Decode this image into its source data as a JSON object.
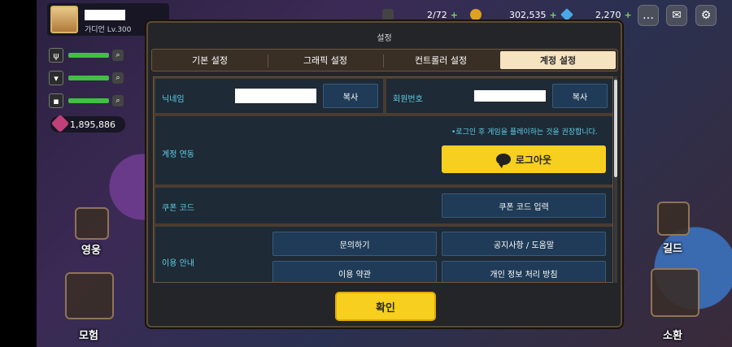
{
  "hud": {
    "level": "가디언 Lv.300",
    "resource1": "2/72",
    "resource2": "302,535",
    "resource3": "2,270",
    "gems": "1,895,886"
  },
  "side": {
    "hero": "영웅",
    "adventure": "모험",
    "guild": "길드",
    "summon": "소환"
  },
  "dialog": {
    "title": "설정",
    "tabs": [
      "기본 설정",
      "그래픽 설정",
      "컨트롤러 설정",
      "계정 설정"
    ],
    "nickname_label": "닉네임",
    "copy_label": "복사",
    "member_label": "회원번호",
    "account_link_label": "계정 연동",
    "login_note": "•로그인 후 게임을 플레이하는 것을 권장합니다.",
    "logout_label": "로그아웃",
    "coupon_label": "쿠폰 코드",
    "coupon_input_label": "쿠폰 코드 입력",
    "usage_label": "이용 안내",
    "inquiry_label": "문의하기",
    "notice_label": "공지사항 / 도움말",
    "terms_label": "이용 약관",
    "privacy_label": "개인 정보 처리 방침",
    "confirm_label": "확인"
  },
  "colors": {
    "accent_yellow": "#f7cf1e",
    "panel_bg": "#1e2a36",
    "label_cyan": "#5fd0e8"
  }
}
